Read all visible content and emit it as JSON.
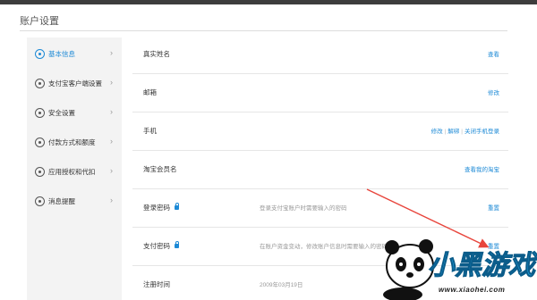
{
  "page": {
    "title": "账户设置"
  },
  "sidebar": {
    "items": [
      {
        "label": "基本信息",
        "icon": "user-icon",
        "active": true
      },
      {
        "label": "支付宝客户端设置",
        "icon": "phone-icon",
        "active": false
      },
      {
        "label": "安全设置",
        "icon": "lock-icon",
        "active": false
      },
      {
        "label": "付款方式和额度",
        "icon": "yen-icon",
        "active": false
      },
      {
        "label": "应用授权和代扣",
        "icon": "check-icon",
        "active": false
      },
      {
        "label": "消息提醒",
        "icon": "message-icon",
        "active": false
      }
    ]
  },
  "rows": [
    {
      "name": "真实姓名",
      "desc": "",
      "actions": [
        "查看"
      ]
    },
    {
      "name": "邮箱",
      "desc": "",
      "actions": [
        "修改"
      ]
    },
    {
      "name": "手机",
      "desc": "",
      "actions": [
        "修改",
        "解绑",
        "关闭手机登录"
      ]
    },
    {
      "name": "淘宝会员名",
      "desc": "",
      "actions": [
        "查看我的淘宝"
      ]
    },
    {
      "name": "登录密码",
      "desc": "登录支付宝账户时需要输入的密码",
      "actions": [
        "重置"
      ]
    },
    {
      "name": "支付密码",
      "desc": "在账户资金变动，修改账户信息时需要输入的密码",
      "actions": [
        "重置"
      ]
    },
    {
      "name": "注册时间",
      "desc": "2009年03月19日",
      "actions": []
    }
  ],
  "watermark": {
    "brand": "小黑游戏",
    "site": "www.xiaohei.com"
  },
  "colors": {
    "accent": "#1d8ad6",
    "arrow": "#e8453c"
  }
}
